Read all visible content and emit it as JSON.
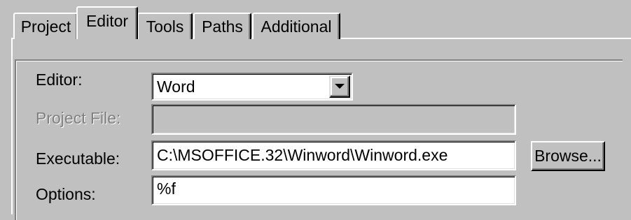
{
  "tabs": [
    {
      "label": "Project",
      "active": false
    },
    {
      "label": "Editor",
      "active": true
    },
    {
      "label": "Tools",
      "active": false
    },
    {
      "label": "Paths",
      "active": false
    },
    {
      "label": "Additional",
      "active": false
    }
  ],
  "form": {
    "editor": {
      "label": "Editor:",
      "value": "Word",
      "control": "dropdown"
    },
    "project_file": {
      "label": "Project File:",
      "value": "",
      "enabled": false
    },
    "executable": {
      "label": "Executable:",
      "value": "C:\\MSOFFICE.32\\Winword\\Winword.exe"
    },
    "options": {
      "label": "Options:",
      "value": "%f"
    }
  },
  "buttons": {
    "browse": "Browse..."
  },
  "colors": {
    "face": "#c0c0c0",
    "highlight": "#ffffff",
    "shadow": "#808080",
    "dark_shadow": "#000000",
    "field": "#ffffff"
  },
  "icons": {
    "dropdown": "chevron-down-icon"
  }
}
